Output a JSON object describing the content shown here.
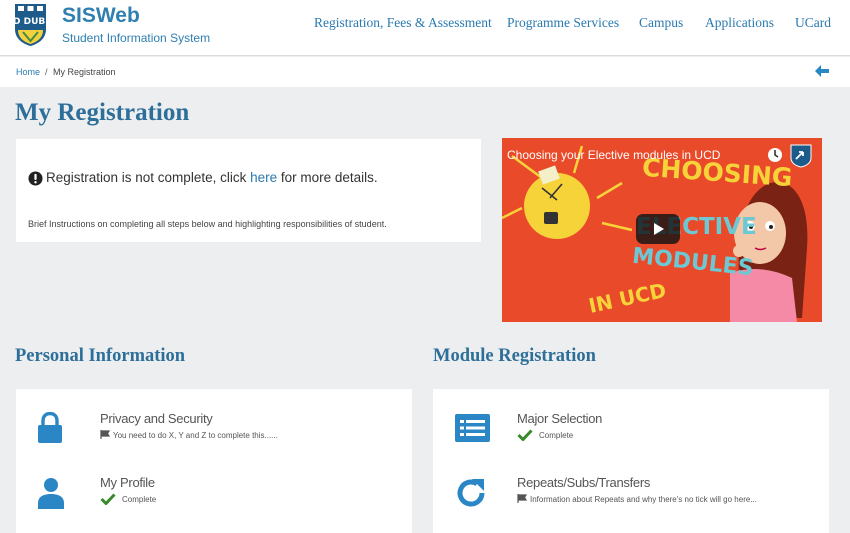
{
  "brand": {
    "logo_text": "UCD DUBLIN",
    "title": "SISWeb",
    "subtitle": "Student Information System"
  },
  "nav": {
    "items": [
      {
        "label": "Registration, Fees & Assessment"
      },
      {
        "label": "Programme Services"
      },
      {
        "label": "Campus"
      },
      {
        "label": "Applications"
      },
      {
        "label": "UCard"
      }
    ]
  },
  "breadcrumb": {
    "home": "Home",
    "separator": "/",
    "current": "My Registration"
  },
  "page_title": "My Registration",
  "notice": {
    "icon": "exclamation-circle-icon",
    "text_before": "Registration is not complete, click ",
    "link_text": "here",
    "text_after": " for more details.",
    "brief": "Brief Instructions on completing all steps below and highlighting responsibilities of student."
  },
  "video": {
    "title": "Choosing your Elective modules in UCD",
    "line1": "CHOOSING",
    "line2": "ELECTIVE",
    "line3": "MODULES",
    "line4": "IN UCD"
  },
  "sections": {
    "personal": {
      "title": "Personal Information",
      "items": [
        {
          "title": "Privacy and Security",
          "status": "You need to do X, Y and Z to complete this......",
          "icon": "lock-icon"
        },
        {
          "title": "My Profile",
          "status": "Complete",
          "icon": "user-icon"
        }
      ]
    },
    "module": {
      "title": "Module Registration",
      "items": [
        {
          "title": "Major Selection",
          "status": "Complete",
          "icon": "list-icon"
        },
        {
          "title": "Repeats/Subs/Transfers",
          "status": "Information about Repeats and why there's no tick will go here...",
          "icon": "refresh-icon"
        }
      ]
    }
  },
  "colors": {
    "accent": "#2e6f99",
    "link": "#2a7ab0",
    "icon_blue": "#2b86c6",
    "check_green": "#3a8a2c",
    "video_bg": "#e94a2a"
  }
}
